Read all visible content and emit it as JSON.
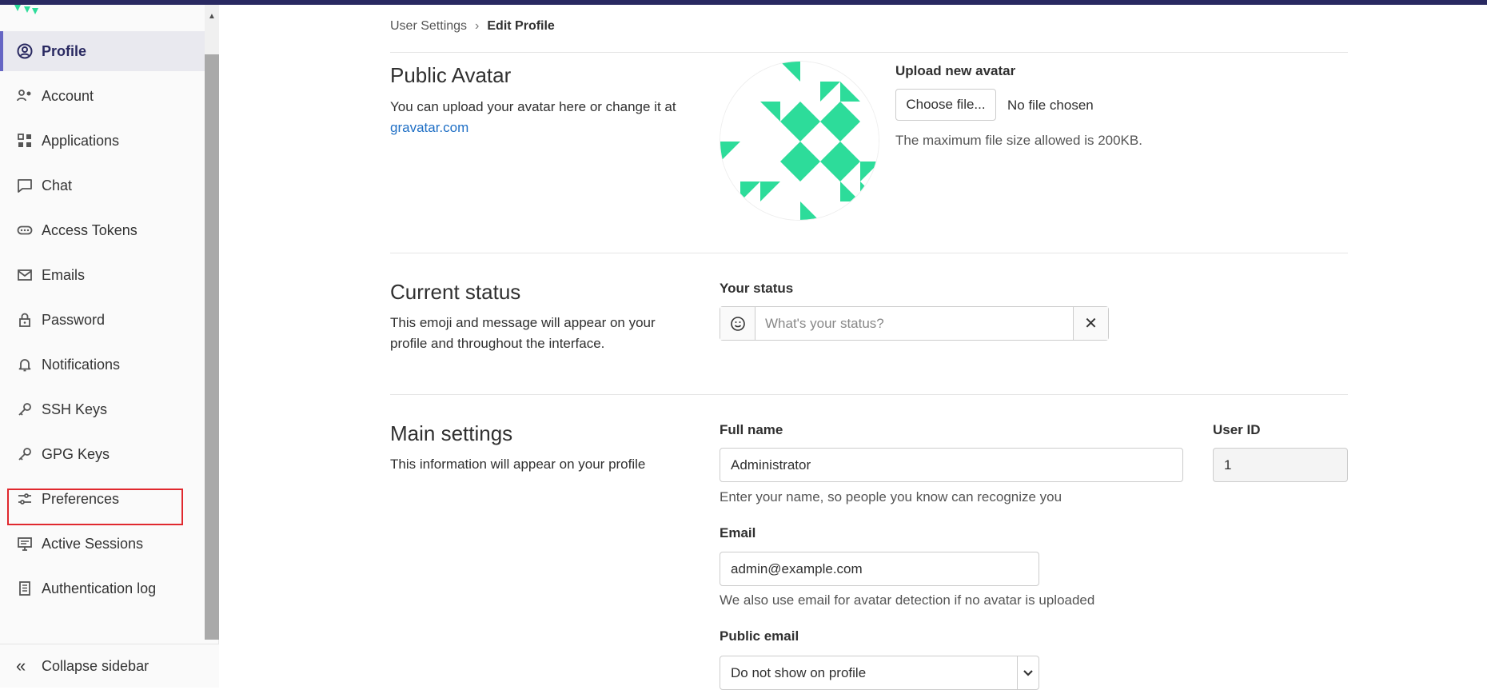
{
  "breadcrumb": {
    "parent": "User Settings",
    "current": "Edit Profile"
  },
  "sidebar": {
    "items": [
      {
        "label": "Profile",
        "icon": "profile-icon",
        "active": true
      },
      {
        "label": "Account",
        "icon": "account-icon"
      },
      {
        "label": "Applications",
        "icon": "applications-icon"
      },
      {
        "label": "Chat",
        "icon": "chat-icon"
      },
      {
        "label": "Access Tokens",
        "icon": "token-icon"
      },
      {
        "label": "Emails",
        "icon": "mail-icon"
      },
      {
        "label": "Password",
        "icon": "lock-icon"
      },
      {
        "label": "Notifications",
        "icon": "bell-icon"
      },
      {
        "label": "SSH Keys",
        "icon": "key-icon"
      },
      {
        "label": "GPG Keys",
        "icon": "key-icon"
      },
      {
        "label": "Preferences",
        "icon": "preferences-icon"
      },
      {
        "label": "Active Sessions",
        "icon": "monitor-icon"
      },
      {
        "label": "Authentication log",
        "icon": "log-icon"
      }
    ],
    "collapse_label": "Collapse sidebar"
  },
  "avatar_section": {
    "title": "Public Avatar",
    "desc": "You can upload your avatar here or change it at",
    "link": "gravatar.com",
    "upload_label": "Upload new avatar",
    "choose_button": "Choose file...",
    "no_file": "No file chosen",
    "max_size": "The maximum file size allowed is 200KB."
  },
  "status_section": {
    "title": "Current status",
    "desc": "This emoji and message will appear on your profile and throughout the interface.",
    "label": "Your status",
    "placeholder": "What's your status?"
  },
  "main_section": {
    "title": "Main settings",
    "desc": "This information will appear on your profile",
    "full_name_label": "Full name",
    "full_name_value": "Administrator",
    "full_name_help": "Enter your name, so people you know can recognize you",
    "user_id_label": "User ID",
    "user_id_value": "1",
    "email_label": "Email",
    "email_value": "admin@example.com",
    "email_help": "We also use email for avatar detection if no avatar is uploaded",
    "public_email_label": "Public email",
    "public_email_value": "Do not show on profile"
  },
  "colors": {
    "accent": "#292961",
    "avatar_green": "#2ddc9a",
    "highlight": "#e0282e",
    "link": "#1f6fc5"
  }
}
